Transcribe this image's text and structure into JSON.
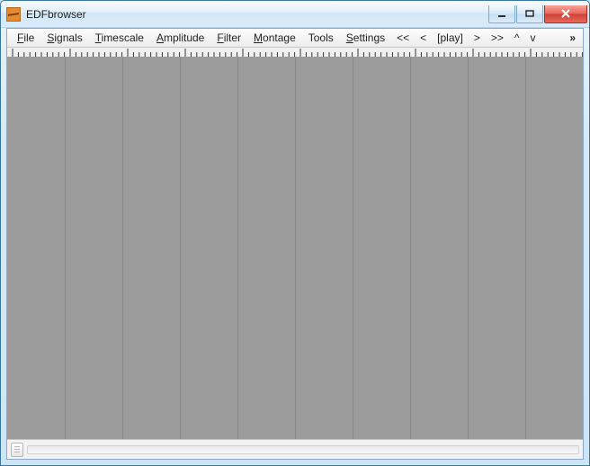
{
  "window": {
    "title": "EDFbrowser"
  },
  "menu": {
    "file": "File",
    "signals": "Signals",
    "timescale": "Timescale",
    "amplitude": "Amplitude",
    "filter": "Filter",
    "montage": "Montage",
    "tools": "Tools",
    "settings": "Settings",
    "nav_rew_fast": "<<",
    "nav_rew": "<",
    "nav_play": "[play]",
    "nav_fwd": ">",
    "nav_fwd_fast": ">>",
    "nav_up": "^",
    "nav_down": "v",
    "overflow": "»"
  },
  "canvas": {
    "gridline_count": 10
  }
}
